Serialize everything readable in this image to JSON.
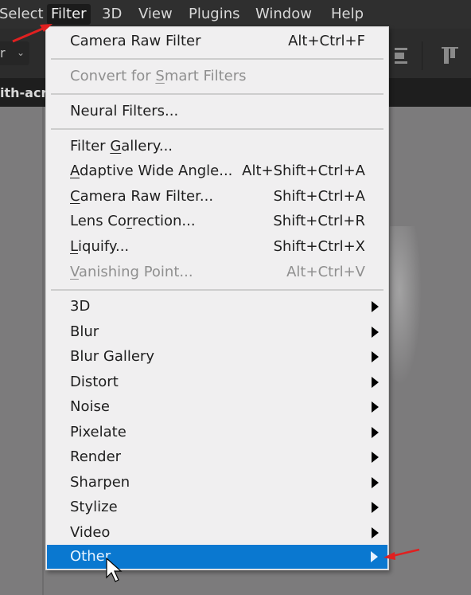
{
  "menubar": {
    "items": [
      {
        "label": "Select",
        "active": false
      },
      {
        "label": "Filter",
        "active": true
      },
      {
        "label": "3D",
        "active": false
      },
      {
        "label": "View",
        "active": false
      },
      {
        "label": "Plugins",
        "active": false
      },
      {
        "label": "Window",
        "active": false
      },
      {
        "label": "Help",
        "active": false
      }
    ]
  },
  "options_bar": {
    "dropdown_partial_label": "r",
    "dropdown_icon": "chevron-down-icon",
    "icons": [
      "align-center-icon",
      "align-top-icon"
    ]
  },
  "document_tab": {
    "partial_title": "ith-acr"
  },
  "filter_menu": {
    "highlight_color": "#0a78d0",
    "last_filter": {
      "label": "Camera Raw Filter",
      "shortcut": "Alt+Ctrl+F",
      "enabled": true
    },
    "convert_smart": {
      "label_pre": "Convert for ",
      "mnemonic": "S",
      "label_post": "mart Filters",
      "enabled": false
    },
    "neural": {
      "label": "Neural Filters...",
      "enabled": true
    },
    "filters": [
      {
        "label_pre": "Filter ",
        "mnemonic": "G",
        "label_post": "allery...",
        "shortcut": "",
        "enabled": true
      },
      {
        "label_pre": "",
        "mnemonic": "A",
        "label_post": "daptive Wide Angle...",
        "shortcut": "Alt+Shift+Ctrl+A",
        "enabled": true
      },
      {
        "label_pre": "",
        "mnemonic": "C",
        "label_post": "amera Raw Filter...",
        "shortcut": "Shift+Ctrl+A",
        "enabled": true
      },
      {
        "label_pre": "Lens Co",
        "mnemonic": "r",
        "label_post": "rection...",
        "shortcut": "Shift+Ctrl+R",
        "enabled": true
      },
      {
        "label_pre": "",
        "mnemonic": "L",
        "label_post": "iquify...",
        "shortcut": "Shift+Ctrl+X",
        "enabled": true
      },
      {
        "label_pre": "",
        "mnemonic": "V",
        "label_post": "anishing Point...",
        "shortcut": "Alt+Ctrl+V",
        "enabled": false
      }
    ],
    "submenus": [
      {
        "label": "3D",
        "highlighted": false
      },
      {
        "label": "Blur",
        "highlighted": false
      },
      {
        "label": "Blur Gallery",
        "highlighted": false
      },
      {
        "label": "Distort",
        "highlighted": false
      },
      {
        "label": "Noise",
        "highlighted": false
      },
      {
        "label": "Pixelate",
        "highlighted": false
      },
      {
        "label": "Render",
        "highlighted": false
      },
      {
        "label": "Sharpen",
        "highlighted": false
      },
      {
        "label": "Stylize",
        "highlighted": false
      },
      {
        "label": "Video",
        "highlighted": false
      },
      {
        "label": "Other",
        "highlighted": true
      }
    ]
  },
  "annotations": {
    "arrow_color": "#e02020",
    "arrows": [
      "pointer-to-filter-menu",
      "pointer-to-other-submenu"
    ]
  }
}
